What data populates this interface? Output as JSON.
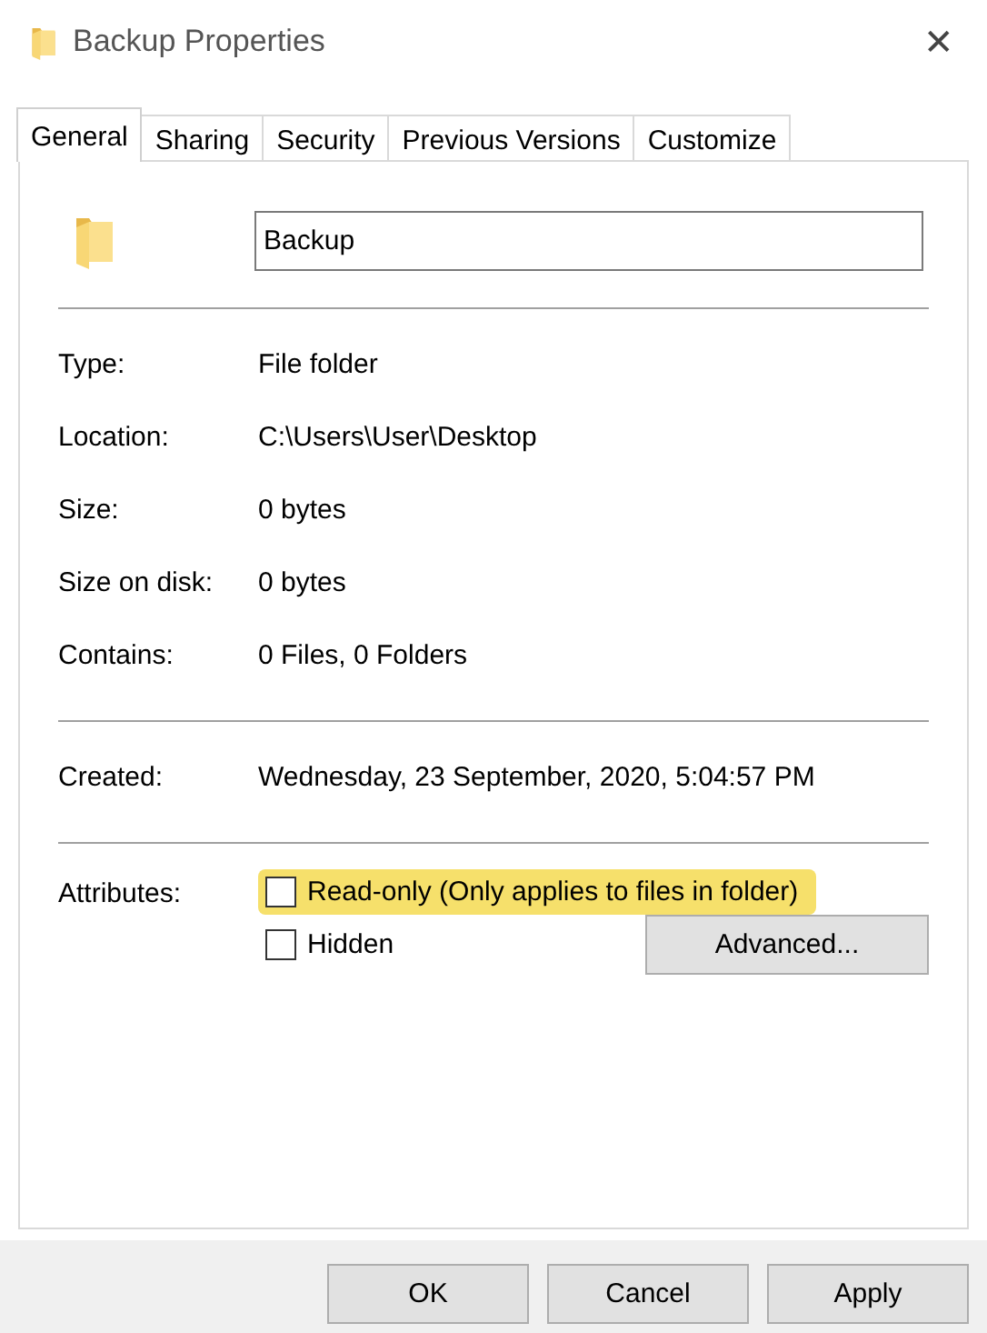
{
  "window": {
    "title": "Backup Properties",
    "close": "✕"
  },
  "tabs": [
    {
      "label": "General",
      "selected": true
    },
    {
      "label": "Sharing",
      "selected": false
    },
    {
      "label": "Security",
      "selected": false
    },
    {
      "label": "Previous Versions",
      "selected": false
    },
    {
      "label": "Customize",
      "selected": false
    }
  ],
  "name_field": {
    "value": "Backup"
  },
  "groups": [
    [
      {
        "label": "Type:",
        "value": "File folder"
      },
      {
        "label": "Location:",
        "value": "C:\\Users\\User\\Desktop"
      },
      {
        "label": "Size:",
        "value": "0 bytes"
      },
      {
        "label": "Size on disk:",
        "value": "0 bytes"
      },
      {
        "label": "Contains:",
        "value": "0 Files, 0 Folders"
      }
    ],
    [
      {
        "label": "Created:",
        "value": "Wednesday, 23 September, 2020, 5:04:57 PM"
      }
    ]
  ],
  "attributes": {
    "label": "Attributes:",
    "items": [
      {
        "label": "Read-only (Only applies to files in folder)",
        "checked": false,
        "highlighted": true
      },
      {
        "label": "Hidden",
        "checked": false,
        "highlighted": false
      }
    ],
    "advanced_button": "Advanced..."
  },
  "buttons": [
    "OK",
    "Cancel",
    "Apply"
  ]
}
